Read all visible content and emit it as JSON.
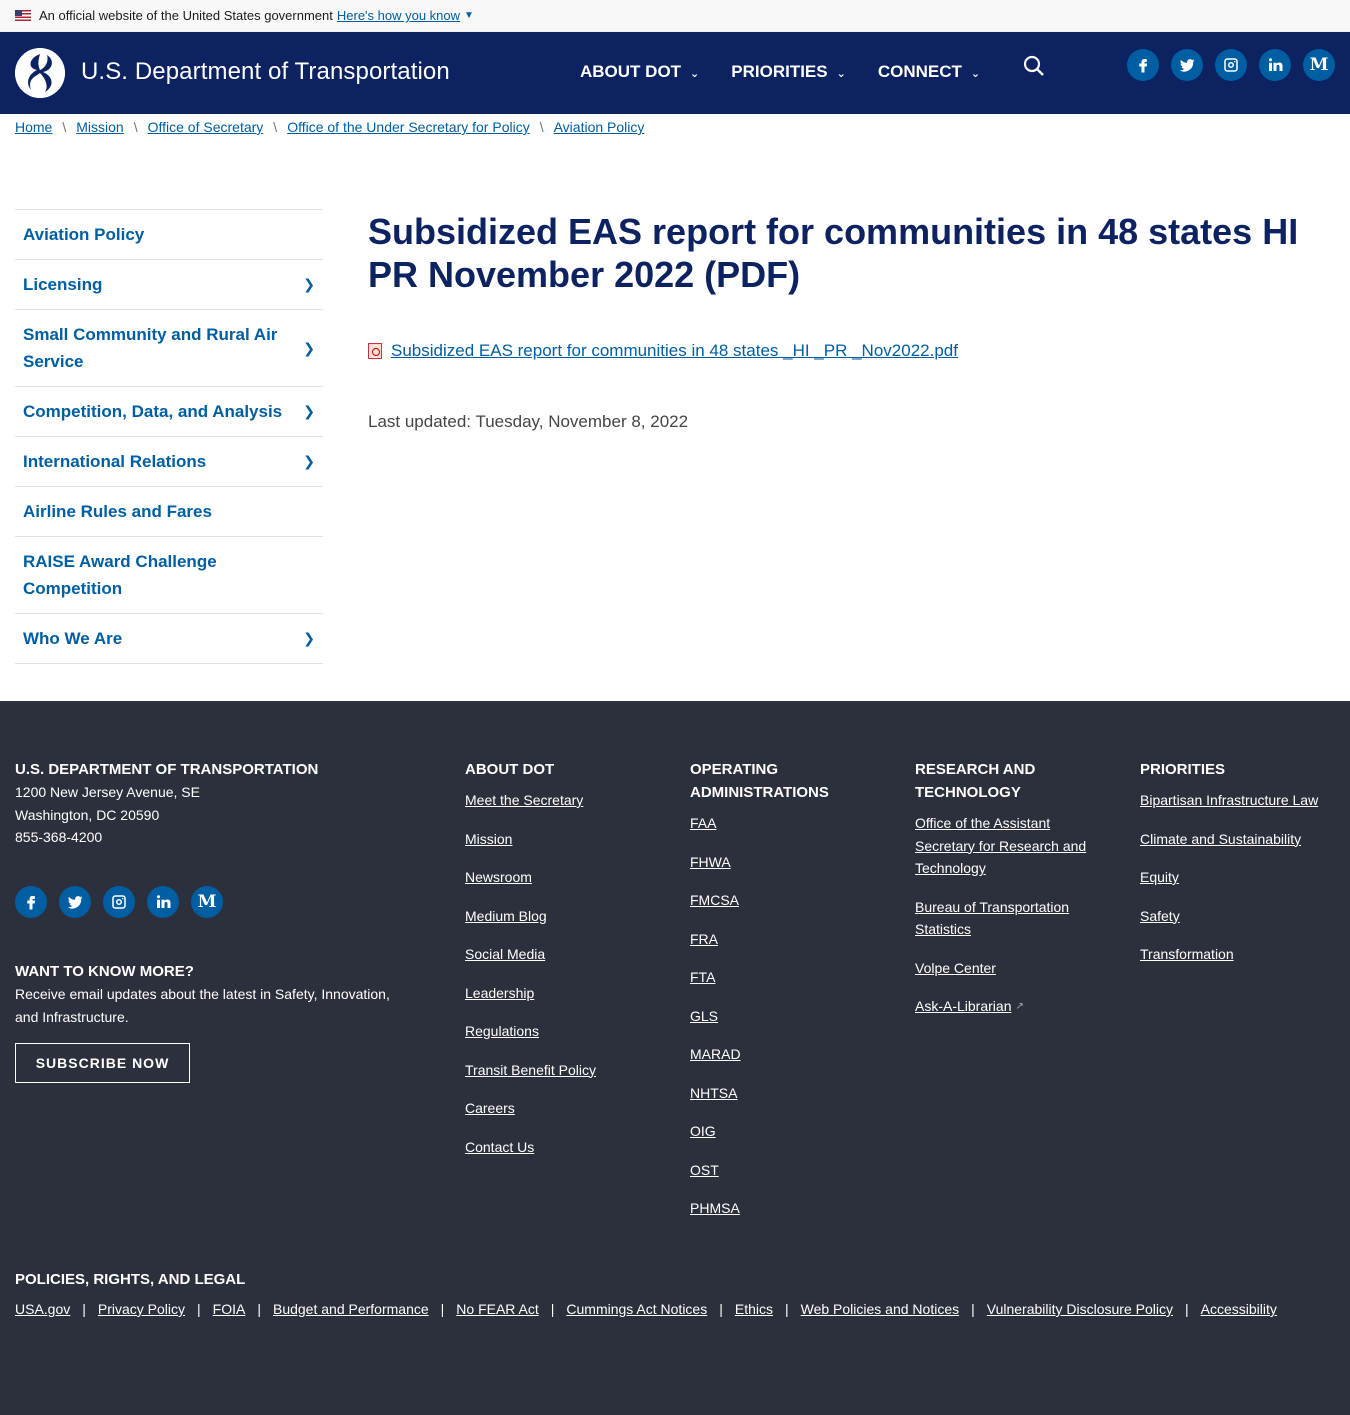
{
  "gov_banner": {
    "text": "An official website of the United States government",
    "link": "Here's how you know"
  },
  "header": {
    "site_title": "U.S. Department of Transportation",
    "nav": [
      {
        "label": "ABOUT DOT"
      },
      {
        "label": "PRIORITIES"
      },
      {
        "label": "CONNECT"
      }
    ],
    "social": [
      "facebook-icon",
      "twitter-icon",
      "instagram-icon",
      "linkedin-icon",
      "medium-icon"
    ]
  },
  "breadcrumb": [
    "Home",
    "Mission",
    "Office of Secretary",
    "Office of the Under Secretary for Policy",
    "Aviation Policy"
  ],
  "sidebar": {
    "items": [
      {
        "label": "Aviation Policy",
        "has_children": false
      },
      {
        "label": "Licensing",
        "has_children": true
      },
      {
        "label": "Small Community and Rural Air Service",
        "has_children": true
      },
      {
        "label": "Competition, Data, and Analysis",
        "has_children": true
      },
      {
        "label": "International Relations",
        "has_children": true
      },
      {
        "label": "Airline Rules and Fares",
        "has_children": false
      },
      {
        "label": "RAISE Award Challenge Competition",
        "has_children": false
      },
      {
        "label": "Who We Are",
        "has_children": true
      }
    ]
  },
  "main": {
    "title": "Subsidized EAS report for communities in 48 states HI PR November 2022 (PDF)",
    "file_link": "Subsidized EAS report for communities in 48 states _HI _PR _Nov2022.pdf",
    "last_updated": "Last updated: Tuesday, November 8, 2022"
  },
  "footer": {
    "org": {
      "name": "U.S. DEPARTMENT OF TRANSPORTATION",
      "address1": "1200 New Jersey Avenue, SE",
      "address2": "Washington, DC 20590",
      "phone": "855-368-4200"
    },
    "want": {
      "heading": "WANT TO KNOW MORE?",
      "text": "Receive email updates about the latest in Safety, Innovation, and Infrastructure.",
      "button": "SUBSCRIBE NOW"
    },
    "about": {
      "heading": "ABOUT DOT",
      "links": [
        "Meet the Secretary",
        "Mission",
        "Newsroom",
        "Medium Blog",
        "Social Media",
        "Leadership",
        "Regulations",
        "Transit Benefit Policy",
        "Careers",
        "Contact Us"
      ]
    },
    "operating": {
      "heading": "OPERATING ADMINISTRATIONS",
      "links": [
        "FAA",
        "FHWA",
        "FMCSA",
        "FRA",
        "FTA",
        "GLS",
        "MARAD",
        "NHTSA",
        "OIG",
        "OST",
        "PHMSA"
      ]
    },
    "research": {
      "heading": "RESEARCH AND TECHNOLOGY",
      "links": [
        "Office of the Assistant Secretary for Research and Technology",
        "Bureau of Transportation Statistics",
        "Volpe Center",
        "Ask-A-Librarian"
      ]
    },
    "priorities": {
      "heading": "PRIORITIES",
      "links": [
        "Bipartisan Infrastructure Law",
        "Climate and Sustainability",
        "Equity",
        "Safety",
        "Transformation"
      ]
    },
    "policies": {
      "heading": "POLICIES, RIGHTS, AND LEGAL",
      "links": [
        "USA.gov",
        "Privacy Policy",
        "FOIA",
        "Budget and Performance",
        "No FEAR Act",
        "Cummings Act Notices",
        "Ethics",
        "Web Policies and Notices",
        "Vulnerability Disclosure Policy",
        "Accessibility"
      ]
    }
  },
  "colors": {
    "header_bg": "#0d2260",
    "link": "#005ea2",
    "footer_bg": "#2c303c"
  }
}
